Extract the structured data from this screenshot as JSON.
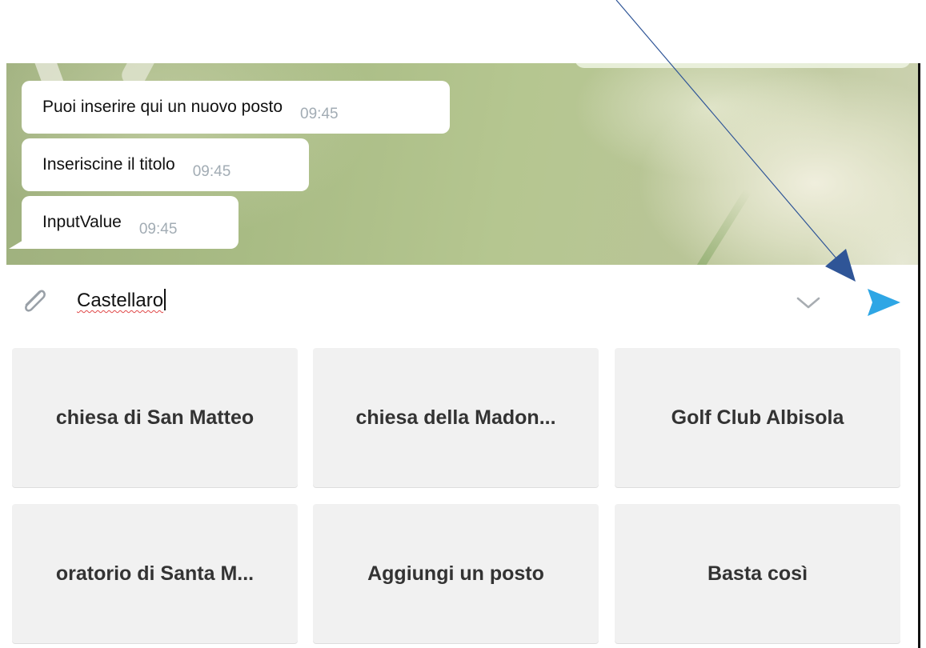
{
  "messages": [
    {
      "text": "Puoi inserire qui un nuovo posto",
      "time": "09:45"
    },
    {
      "text": "Inseriscine il titolo",
      "time": "09:45"
    },
    {
      "text": "InputValue",
      "time": "09:45"
    }
  ],
  "input": {
    "value": "Castellaro"
  },
  "icons": {
    "attach": "paperclip-icon",
    "keyboard_toggle": "chevron-down-icon",
    "send": "send-icon",
    "send_color": "#2ea6e5"
  },
  "keyboard": {
    "buttons": [
      "chiesa di San Matteo",
      "chiesa della Madon...",
      "Golf Club Albisola",
      "oratorio di Santa M...",
      "Aggiungi un posto",
      "Basta così"
    ]
  }
}
